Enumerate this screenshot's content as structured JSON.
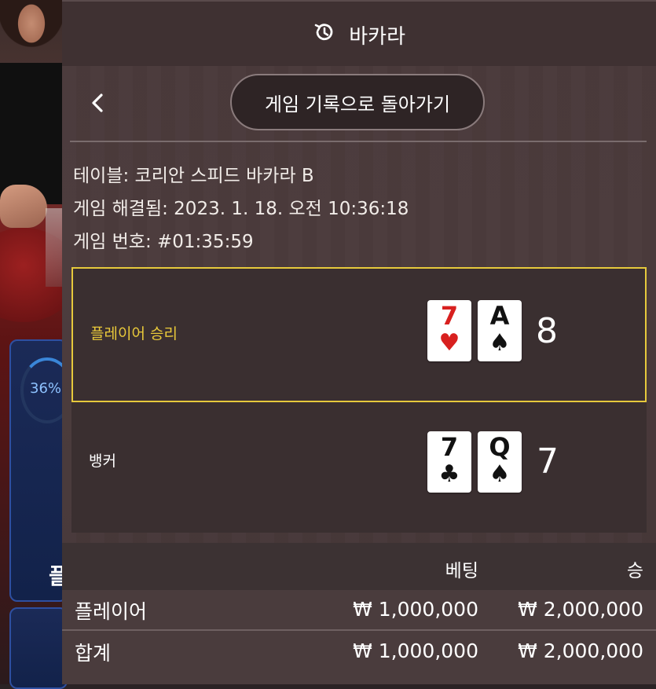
{
  "header": {
    "title": "바카라",
    "icon": "history-icon"
  },
  "nav": {
    "back_label": "게임 기록으로 돌아가기"
  },
  "info": {
    "table": "테이블: 코리안 스피드 바카라 B",
    "resolved": "게임 해결됨: 2023. 1. 18. 오전 10:36:18",
    "number": "게임 번호: #01:35:59"
  },
  "results": {
    "player": {
      "label": "플레이어 승리",
      "cards": [
        {
          "rank": "7",
          "suit": "♥",
          "color": "red"
        },
        {
          "rank": "A",
          "suit": "♠",
          "color": "black"
        }
      ],
      "score": "8"
    },
    "banker": {
      "label": "뱅커",
      "cards": [
        {
          "rank": "7",
          "suit": "♣",
          "color": "black"
        },
        {
          "rank": "Q",
          "suit": "♠",
          "color": "black"
        }
      ],
      "score": "7"
    }
  },
  "bets": {
    "headers": {
      "bet": "베팅",
      "win": "승"
    },
    "rows": [
      {
        "label": "플레이어",
        "bet": "₩ 1,000,000",
        "win": "₩ 2,000,000"
      }
    ],
    "total": {
      "label": "합계",
      "bet": "₩ 1,000,000",
      "win": "₩ 2,000,000"
    }
  },
  "background": {
    "progress_label": "36%",
    "bet_glyph": "플"
  },
  "colors": {
    "win_border": "#e6c93c",
    "win_text": "#e9c93a",
    "card_red": "#d8201f"
  }
}
